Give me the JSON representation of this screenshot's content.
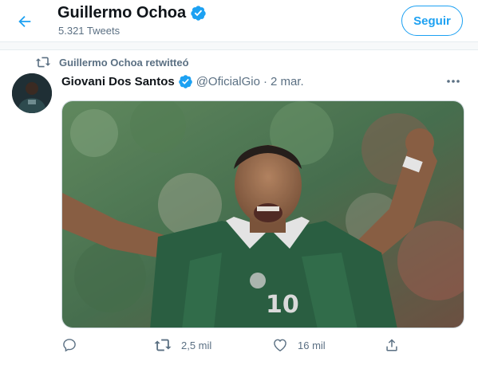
{
  "header": {
    "title": "Guillermo Ochoa",
    "subtitle": "5.321 Tweets",
    "follow_label": "Seguir",
    "back_icon": "arrow-left-icon",
    "verified_icon": "verified-badge-icon"
  },
  "retweet_notice": {
    "icon": "retweet-icon",
    "text": "Guillermo Ochoa retwitteó"
  },
  "tweet": {
    "author_name": "Giovani Dos Santos",
    "handle": "@OficialGio",
    "separator": "·",
    "date": "2 mar.",
    "verified_icon": "verified-badge-icon",
    "more_icon": "more-dots-icon",
    "media": {
      "type": "photo",
      "jersey_number": "10"
    },
    "actions": {
      "reply": {
        "icon": "reply-icon",
        "count": ""
      },
      "retweet": {
        "icon": "retweet-icon",
        "count": "2,5 mil"
      },
      "like": {
        "icon": "heart-icon",
        "count": "16 mil"
      },
      "share": {
        "icon": "share-icon",
        "count": ""
      }
    }
  },
  "colors": {
    "accent": "#1da1f2",
    "secondary_text": "#5b7083",
    "border": "#e6ecf0"
  }
}
